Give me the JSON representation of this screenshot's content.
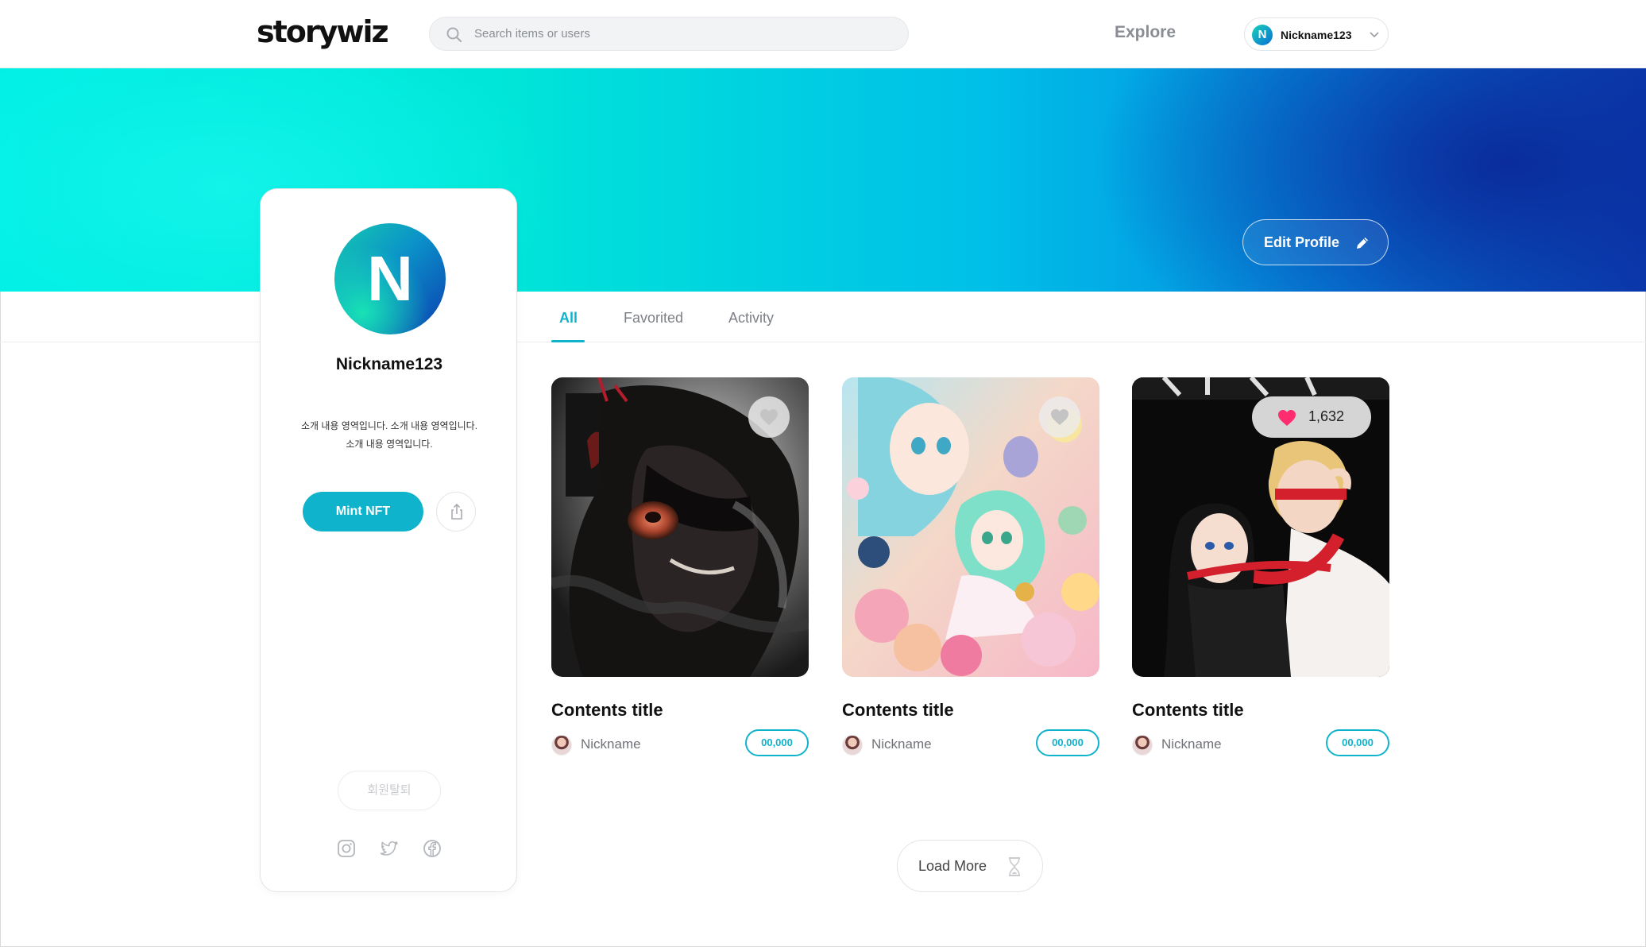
{
  "header": {
    "logo": "storywiz",
    "search_placeholder": "Search items or users",
    "explore_label": "Explore",
    "user": {
      "initial": "N",
      "name": "Nickname123"
    }
  },
  "banner": {
    "edit_profile_label": "Edit Profile"
  },
  "profile": {
    "avatar_initial": "N",
    "name": "Nickname123",
    "bio_line1": "소개 내용 영역입니다. 소개 내용 영역입니다.",
    "bio_line2": "소개 내용 영역입니다.",
    "mint_label": "Mint NFT",
    "withdraw_label": "회원탈퇴",
    "social_icons": [
      "instagram-icon",
      "twitter-icon",
      "facebook-icon"
    ]
  },
  "tabs": [
    {
      "label": "All",
      "active": true
    },
    {
      "label": "Favorited",
      "active": false
    },
    {
      "label": "Activity",
      "active": false
    }
  ],
  "cards": [
    {
      "title": "Contents title",
      "nickname": "Nickname",
      "price": "00,000",
      "favorite_count": null
    },
    {
      "title": "Contents title",
      "nickname": "Nickname",
      "price": "00,000",
      "favorite_count": null
    },
    {
      "title": "Contents title",
      "nickname": "Nickname",
      "price": "00,000",
      "favorite_count": "1,632"
    }
  ],
  "load_more_label": "Load More",
  "colors": {
    "accent": "#0fb3cc",
    "heart": "#ff2d6f",
    "banner_start": "#00f0e6",
    "banner_end": "#0a3db3"
  }
}
